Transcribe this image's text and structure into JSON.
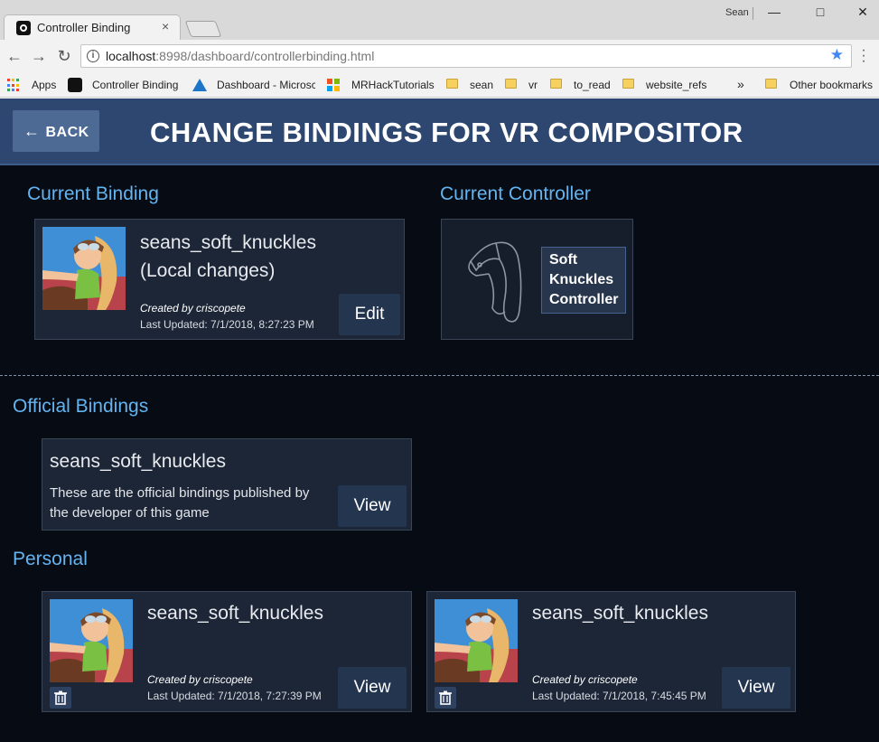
{
  "browser": {
    "tab_title": "Controller Binding",
    "tab_close": "×",
    "user": "Sean",
    "url_host": "localhost",
    "url_rest": ":8998/dashboard/controllerbinding.html",
    "bookmarks": {
      "apps": "Apps",
      "items": [
        "Controller Binding",
        "Dashboard - Microsc",
        "MRHackTutorials",
        "sean",
        "vr",
        "to_read",
        "website_refs"
      ],
      "more": "»",
      "other": "Other bookmarks"
    }
  },
  "header": {
    "back_label": "BACK",
    "title": "CHANGE BINDINGS FOR VR COMPOSITOR"
  },
  "current_binding": {
    "section_label": "Current Binding",
    "name": "seans_soft_knuckles",
    "status": "(Local changes)",
    "created_by": "Created by criscopete",
    "last_updated": "Last Updated: 7/1/2018, 8:27:23 PM",
    "button": "Edit"
  },
  "current_controller": {
    "section_label": "Current Controller",
    "name": "Soft Knuckles Controller"
  },
  "official": {
    "section_label": "Official Bindings",
    "name": "seans_soft_knuckles",
    "description": "These are the official bindings published by the developer of this game",
    "button": "View"
  },
  "personal": {
    "section_label": "Personal",
    "items": [
      {
        "name": "seans_soft_knuckles",
        "created_by": "Created by criscopete",
        "last_updated": "Last Updated: 7/1/2018, 7:27:39 PM",
        "button": "View"
      },
      {
        "name": "seans_soft_knuckles",
        "created_by": "Created by criscopete",
        "last_updated": "Last Updated: 7/1/2018, 7:45:45 PM",
        "button": "View"
      }
    ]
  },
  "colors": {
    "accent_blue": "#63b4f0",
    "header_bg": "#2d4770",
    "card_bg": "#1c2637",
    "page_bg": "#070b14"
  }
}
